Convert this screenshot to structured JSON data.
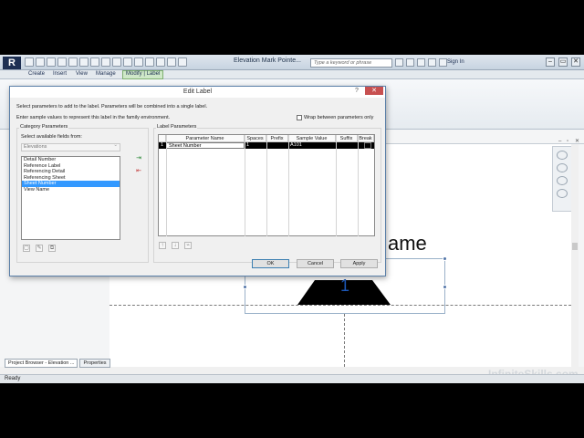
{
  "app": {
    "logo": "R",
    "document_title": "Elevation Mark Pointe...",
    "search_placeholder": "Type a keyword or phrase",
    "sign_in": "Sign In",
    "tabs": [
      "Create",
      "Insert",
      "View",
      "Manage",
      "Modify | Label"
    ],
    "active_tab": "Modify | Label"
  },
  "canvas": {
    "label_text_fragment": "ame",
    "marker_number": "1"
  },
  "bottom_tabs": {
    "project_browser": "Project Browser - Elevation ...",
    "properties": "Properties"
  },
  "status": {
    "text": "Ready"
  },
  "watermark": "InfiniteSkills.com",
  "dialog": {
    "title": "Edit Label",
    "help": "?",
    "close": "✕",
    "instruction1": "Select parameters to add to the label.  Parameters will be combined into a single label.",
    "instruction2": "Enter sample values to represent this label in the family environment.",
    "wrap_label": "Wrap between parameters only",
    "category_group_title": "Category Parameters",
    "available_fields_label": "Select available fields from:",
    "category_combo_value": "Elevations",
    "fields": [
      "Detail Number",
      "Reference Label",
      "Referencing Detail",
      "Referencing Sheet",
      "Sheet Number",
      "View Name"
    ],
    "selected_field": "Sheet Number",
    "label_params_title": "Label Parameters",
    "table_headers": [
      "Parameter Name",
      "Spaces",
      "Prefix",
      "Sample Value",
      "Suffix",
      "Break"
    ],
    "rows": [
      {
        "index": "1",
        "parameter_name": "Sheet Number",
        "spaces": "1",
        "prefix": "",
        "sample_value": "A101",
        "suffix": "",
        "break": ""
      }
    ],
    "buttons": {
      "ok": "OK",
      "cancel": "Cancel",
      "apply": "Apply"
    }
  }
}
